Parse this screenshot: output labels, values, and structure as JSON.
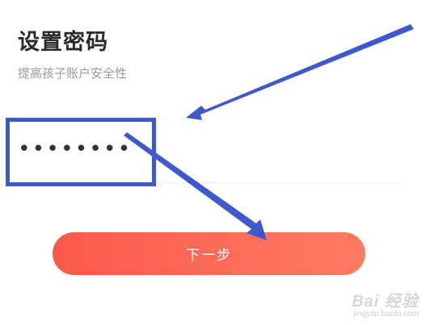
{
  "header": {
    "title": "设置密码",
    "subtitle": "提高孩子账户安全性"
  },
  "password_field": {
    "value": "••••••••"
  },
  "next_button": {
    "label": "下一步"
  },
  "annotations": {
    "highlight_color": "#3f59cc",
    "arrow_color": "#3f59cc"
  },
  "watermark": {
    "logo": "Bai 经验",
    "url": "jingyan.baidu.com"
  },
  "colors": {
    "button_gradient_start": "#fb5a4b",
    "button_gradient_end": "#fe7a64"
  }
}
